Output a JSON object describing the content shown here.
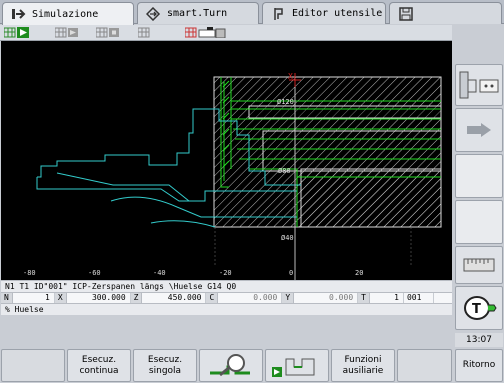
{
  "tabs": [
    {
      "label": "Simulazione",
      "icon": "arrow-right-icon"
    },
    {
      "label": "smart.Turn",
      "icon": "diamond-arrow-icon"
    },
    {
      "label": "Editor utensile",
      "icon": "tool-holder-icon"
    },
    {
      "label": "",
      "icon": "floppy-disk-icon"
    }
  ],
  "graphic": {
    "labels": {
      "d120": "Ø120",
      "d80": "Ø80",
      "d40": "Ø40",
      "x_axis": "X"
    },
    "ticks": [
      "-80",
      "-60",
      "-40",
      "-20",
      "0",
      "20"
    ],
    "colors": {
      "background": "#000000",
      "contour": "#33cccc",
      "stock": "#ffffff",
      "path": "#22dd22",
      "axis": "#cc2222"
    }
  },
  "info": {
    "block_line": "N1 T1 ID\"001\" ICP-Zerspanen längs \\Huelse  G14 Q0",
    "program": "% Huelse"
  },
  "position": {
    "N_label": "N",
    "N_value": "1",
    "X_label": "X",
    "X_value": "300.000",
    "Z_label": "Z",
    "Z_value": "450.000",
    "C_label": "C",
    "C_value": "0.000",
    "Y_label": "Y",
    "Y_value": "0.000",
    "T_label": "T",
    "T_value": "1",
    "T_id": "001"
  },
  "clock": "13:07",
  "softkeys": {
    "continua": "Esecuz.\ncontinua",
    "singola": "Esecuz.\nsingola",
    "funzioni": "Funzioni\nausiliarie",
    "ritorno": "Ritorno"
  }
}
